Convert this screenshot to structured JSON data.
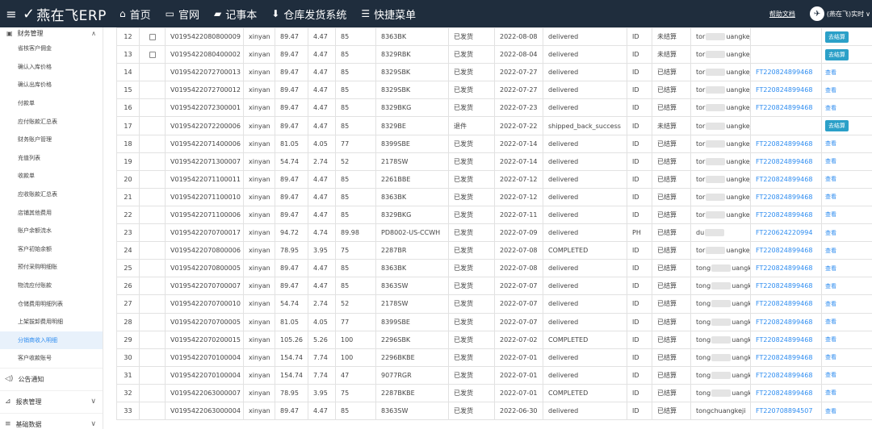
{
  "header": {
    "app_name": "燕在飞ERP",
    "nav": [
      {
        "label": "首页",
        "icon": "home-icon",
        "glyph": "⌂"
      },
      {
        "label": "官网",
        "icon": "monitor-icon",
        "glyph": "▭"
      },
      {
        "label": "记事本",
        "icon": "notebook-icon",
        "glyph": "▰"
      },
      {
        "label": "仓库发货系统",
        "icon": "download-icon",
        "glyph": "⬇"
      },
      {
        "label": "快捷菜单",
        "icon": "menu-list-icon",
        "glyph": "☰"
      }
    ],
    "help_label": "帮助文档",
    "user_name": "(燕在飞)实时",
    "user_caret": "∨"
  },
  "sidebar": {
    "group_title": "财务管理",
    "items": [
      {
        "label": "省核客户佣金",
        "active": false
      },
      {
        "label": "确认入库价格",
        "active": false
      },
      {
        "label": "确认出库价格",
        "active": false
      },
      {
        "label": "付款单",
        "active": false
      },
      {
        "label": "应付账款汇总表",
        "active": false
      },
      {
        "label": "财务账户管理",
        "active": false
      },
      {
        "label": "充值列表",
        "active": false
      },
      {
        "label": "收款单",
        "active": false
      },
      {
        "label": "应收账款汇总表",
        "active": false
      },
      {
        "label": "店铺其他费用",
        "active": false
      },
      {
        "label": "账户余额流水",
        "active": false
      },
      {
        "label": "客户初始余额",
        "active": false
      },
      {
        "label": "预付采购明细账",
        "active": false
      },
      {
        "label": "物流应付账款",
        "active": false
      },
      {
        "label": "仓储费用明细列表",
        "active": false
      },
      {
        "label": "上架拔卸费用明细",
        "active": false
      },
      {
        "label": "分销商收入明细",
        "active": true
      },
      {
        "label": "客户收款账号",
        "active": false
      }
    ],
    "sections": [
      {
        "label": "公告通知",
        "icon": "speaker-icon",
        "glyph": "◁)",
        "has_chevron": false
      },
      {
        "label": "报表管理",
        "icon": "chart-icon",
        "glyph": "⊿",
        "has_chevron": true
      },
      {
        "label": "基础数据",
        "icon": "grid-icon",
        "glyph": "≡",
        "has_chevron": true
      }
    ]
  },
  "table": {
    "settle_label": "去结算",
    "view_label": "查看",
    "rows": [
      {
        "no": "12",
        "cb": true,
        "order": "V0195422080800009",
        "user": "xinyan",
        "amount": "89.47",
        "fee": "4.47",
        "pct": "85",
        "sku": "8363BK",
        "ship": "已发货",
        "date": "2022-08-08",
        "status": "delivered",
        "country": "ID",
        "settle": "未结算",
        "cust_a": "tor",
        "cust_b": "uangkeji",
        "ft": "",
        "action": "settle"
      },
      {
        "no": "13",
        "cb": true,
        "order": "V0195422080400002",
        "user": "xinyan",
        "amount": "89.47",
        "fee": "4.47",
        "pct": "85",
        "sku": "8329RBK",
        "ship": "已发货",
        "date": "2022-08-04",
        "status": "delivered",
        "country": "ID",
        "settle": "未结算",
        "cust_a": "tor",
        "cust_b": "uangkeji",
        "ft": "",
        "action": "settle"
      },
      {
        "no": "14",
        "cb": false,
        "order": "V0195422072700013",
        "user": "xinyan",
        "amount": "89.47",
        "fee": "4.47",
        "pct": "85",
        "sku": "8329SBK",
        "ship": "已发货",
        "date": "2022-07-27",
        "status": "delivered",
        "country": "ID",
        "settle": "已结算",
        "cust_a": "tor",
        "cust_b": "uangkeji",
        "ft": "FT220824899468",
        "action": "view"
      },
      {
        "no": "15",
        "cb": false,
        "order": "V0195422072700012",
        "user": "xinyan",
        "amount": "89.47",
        "fee": "4.47",
        "pct": "85",
        "sku": "8329SBK",
        "ship": "已发货",
        "date": "2022-07-27",
        "status": "delivered",
        "country": "ID",
        "settle": "已结算",
        "cust_a": "tor",
        "cust_b": "uangkeji",
        "ft": "FT220824899468",
        "action": "view"
      },
      {
        "no": "16",
        "cb": false,
        "order": "V0195422072300001",
        "user": "xinyan",
        "amount": "89.47",
        "fee": "4.47",
        "pct": "85",
        "sku": "8329BKG",
        "ship": "已发货",
        "date": "2022-07-23",
        "status": "delivered",
        "country": "ID",
        "settle": "已结算",
        "cust_a": "tor",
        "cust_b": "uangkeji",
        "ft": "FT220824899468",
        "action": "view"
      },
      {
        "no": "17",
        "cb": false,
        "order": "V0195422072200006",
        "user": "xinyan",
        "amount": "89.47",
        "fee": "4.47",
        "pct": "85",
        "sku": "8329BE",
        "ship": "退件",
        "date": "2022-07-22",
        "status": "shipped_back_success",
        "country": "ID",
        "settle": "未结算",
        "cust_a": "tor",
        "cust_b": "uangkeji",
        "ft": "",
        "action": "settle"
      },
      {
        "no": "18",
        "cb": false,
        "order": "V0195422071400006",
        "user": "xinyan",
        "amount": "81.05",
        "fee": "4.05",
        "pct": "77",
        "sku": "8399SBE",
        "ship": "已发货",
        "date": "2022-07-14",
        "status": "delivered",
        "country": "ID",
        "settle": "已结算",
        "cust_a": "tor",
        "cust_b": "uangkeji",
        "ft": "FT220824899468",
        "action": "view"
      },
      {
        "no": "19",
        "cb": false,
        "order": "V0195422071300007",
        "user": "xinyan",
        "amount": "54.74",
        "fee": "2.74",
        "pct": "52",
        "sku": "2178SW",
        "ship": "已发货",
        "date": "2022-07-14",
        "status": "delivered",
        "country": "ID",
        "settle": "已结算",
        "cust_a": "tor",
        "cust_b": "uangkeji",
        "ft": "FT220824899468",
        "action": "view"
      },
      {
        "no": "20",
        "cb": false,
        "order": "V0195422071100011",
        "user": "xinyan",
        "amount": "89.47",
        "fee": "4.47",
        "pct": "85",
        "sku": "2261BBE",
        "ship": "已发货",
        "date": "2022-07-12",
        "status": "delivered",
        "country": "ID",
        "settle": "已结算",
        "cust_a": "tor",
        "cust_b": "uangkeji",
        "ft": "FT220824899468",
        "action": "view"
      },
      {
        "no": "21",
        "cb": false,
        "order": "V0195422071100010",
        "user": "xinyan",
        "amount": "89.47",
        "fee": "4.47",
        "pct": "85",
        "sku": "8363BK",
        "ship": "已发货",
        "date": "2022-07-12",
        "status": "delivered",
        "country": "ID",
        "settle": "已结算",
        "cust_a": "tor",
        "cust_b": "uangkeji",
        "ft": "FT220824899468",
        "action": "view"
      },
      {
        "no": "22",
        "cb": false,
        "order": "V0195422071100006",
        "user": "xinyan",
        "amount": "89.47",
        "fee": "4.47",
        "pct": "85",
        "sku": "8329BKG",
        "ship": "已发货",
        "date": "2022-07-11",
        "status": "delivered",
        "country": "ID",
        "settle": "已结算",
        "cust_a": "tor",
        "cust_b": "uangkeji",
        "ft": "FT220824899468",
        "action": "view"
      },
      {
        "no": "23",
        "cb": false,
        "order": "V0195422070700017",
        "user": "xinyan",
        "amount": "94.72",
        "fee": "4.74",
        "pct": "89.98",
        "sku": "PD8002-US-CCWH",
        "ship": "已发货",
        "date": "2022-07-09",
        "status": "delivered",
        "country": "PH",
        "settle": "已结算",
        "cust_a": "du",
        "cust_b": "",
        "ft": "FT220624220994",
        "action": "view"
      },
      {
        "no": "24",
        "cb": false,
        "order": "V0195422070800006",
        "user": "xinyan",
        "amount": "78.95",
        "fee": "3.95",
        "pct": "75",
        "sku": "2287BR",
        "ship": "已发货",
        "date": "2022-07-08",
        "status": "COMPLETED",
        "country": "ID",
        "settle": "已结算",
        "cust_a": "tor",
        "cust_b": "uangkeji",
        "ft": "FT220824899468",
        "action": "view"
      },
      {
        "no": "25",
        "cb": false,
        "order": "V0195422070800005",
        "user": "xinyan",
        "amount": "89.47",
        "fee": "4.47",
        "pct": "85",
        "sku": "8363BK",
        "ship": "已发货",
        "date": "2022-07-08",
        "status": "delivered",
        "country": "ID",
        "settle": "已结算",
        "cust_a": "tong",
        "cust_b": "uangkeji",
        "ft": "FT220824899468",
        "action": "view"
      },
      {
        "no": "26",
        "cb": false,
        "order": "V0195422070700007",
        "user": "xinyan",
        "amount": "89.47",
        "fee": "4.47",
        "pct": "85",
        "sku": "8363SW",
        "ship": "已发货",
        "date": "2022-07-07",
        "status": "delivered",
        "country": "ID",
        "settle": "已结算",
        "cust_a": "tong",
        "cust_b": "uangkeji",
        "ft": "FT220824899468",
        "action": "view"
      },
      {
        "no": "27",
        "cb": false,
        "order": "V0195422070700010",
        "user": "xinyan",
        "amount": "54.74",
        "fee": "2.74",
        "pct": "52",
        "sku": "2178SW",
        "ship": "已发货",
        "date": "2022-07-07",
        "status": "delivered",
        "country": "ID",
        "settle": "已结算",
        "cust_a": "tong",
        "cust_b": "uangkeji",
        "ft": "FT220824899468",
        "action": "view"
      },
      {
        "no": "28",
        "cb": false,
        "order": "V0195422070700005",
        "user": "xinyan",
        "amount": "81.05",
        "fee": "4.05",
        "pct": "77",
        "sku": "8399SBE",
        "ship": "已发货",
        "date": "2022-07-07",
        "status": "delivered",
        "country": "ID",
        "settle": "已结算",
        "cust_a": "tong",
        "cust_b": "uangkeji",
        "ft": "FT220824899468",
        "action": "view"
      },
      {
        "no": "29",
        "cb": false,
        "order": "V0195422070200015",
        "user": "xinyan",
        "amount": "105.26",
        "fee": "5.26",
        "pct": "100",
        "sku": "2296SBK",
        "ship": "已发货",
        "date": "2022-07-02",
        "status": "COMPLETED",
        "country": "ID",
        "settle": "已结算",
        "cust_a": "tong",
        "cust_b": "uangkeji",
        "ft": "FT220824899468",
        "action": "view"
      },
      {
        "no": "30",
        "cb": false,
        "order": "V0195422070100004",
        "user": "xinyan",
        "amount": "154.74",
        "fee": "7.74",
        "pct": "100",
        "sku": "2296BKBE",
        "ship": "已发货",
        "date": "2022-07-01",
        "status": "delivered",
        "country": "ID",
        "settle": "已结算",
        "cust_a": "tong",
        "cust_b": "uangkeji",
        "ft": "FT220824899468",
        "action": "view"
      },
      {
        "no": "31",
        "cb": false,
        "order": "V0195422070100004",
        "user": "xinyan",
        "amount": "154.74",
        "fee": "7.74",
        "pct": "47",
        "sku": "9077RGR",
        "ship": "已发货",
        "date": "2022-07-01",
        "status": "delivered",
        "country": "ID",
        "settle": "已结算",
        "cust_a": "tong",
        "cust_b": "uangkeji",
        "ft": "FT220824899468",
        "action": "view"
      },
      {
        "no": "32",
        "cb": false,
        "order": "V0195422063000007",
        "user": "xinyan",
        "amount": "78.95",
        "fee": "3.95",
        "pct": "75",
        "sku": "2287BKBE",
        "ship": "已发货",
        "date": "2022-07-01",
        "status": "COMPLETED",
        "country": "ID",
        "settle": "已结算",
        "cust_a": "tong",
        "cust_b": "uangkeji",
        "ft": "FT220824899468",
        "action": "view"
      },
      {
        "no": "33",
        "cb": false,
        "order": "V0195422063000004",
        "user": "xinyan",
        "amount": "89.47",
        "fee": "4.47",
        "pct": "85",
        "sku": "8363SW",
        "ship": "已发货",
        "date": "2022-06-30",
        "status": "delivered",
        "country": "ID",
        "settle": "已结算",
        "cust_a": "tongchuangkeji",
        "cust_b": "",
        "ft": "FT220708894507",
        "action": "view"
      }
    ]
  },
  "colors": {
    "topbar": "#1f2d3d",
    "link": "#2d8cf0",
    "settle_button": "#2ba0c8",
    "active_sidebar": "#e8f1fb"
  }
}
